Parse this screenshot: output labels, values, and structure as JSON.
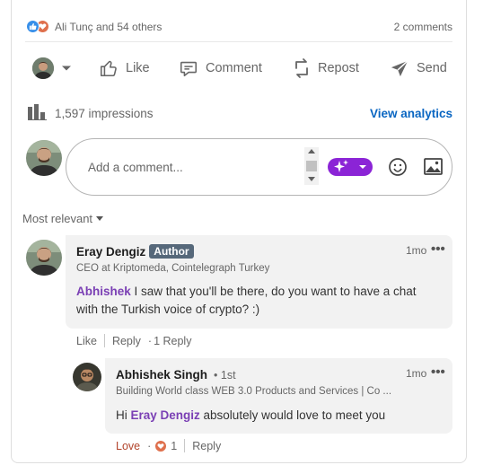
{
  "social": {
    "reactions_text": "Ali Tunç and 54 others",
    "comments_count": "2 comments"
  },
  "actions": {
    "like": "Like",
    "comment": "Comment",
    "repost": "Repost",
    "send": "Send"
  },
  "stats": {
    "impressions": "1,597 impressions",
    "analytics_link": "View analytics"
  },
  "composer": {
    "placeholder": "Add a comment..."
  },
  "sort": {
    "label": "Most relevant"
  },
  "comments": [
    {
      "name": "Eray Dengiz",
      "badge": "Author",
      "headline": "CEO at Kriptomeda, Cointelegraph Turkey",
      "time": "1mo",
      "more": "•••",
      "mention": "Abhishek",
      "text_line1": " I saw that you'll be there, do you want to have a chat",
      "text_line2": "with the Turkish voice of crypto? :)",
      "like_label": "Like",
      "reply_label": "Reply",
      "reply_count": "1 Reply"
    },
    {
      "name": "Abhishek Singh",
      "degree": "• 1st",
      "headline": "Building World class WEB 3.0 Products and Services | Co ...",
      "time": "1mo",
      "more": "•••",
      "text_prefix": "Hi ",
      "mention": "Eray Dengiz",
      "text_suffix": " absolutely would love to meet you",
      "reaction_label": "Love",
      "reaction_count": "1",
      "reply_label": "Reply"
    }
  ],
  "colors": {
    "brand_blue": "#0a66c2",
    "ai_purple": "#8b24d6",
    "mention_purple": "#7a3fb4",
    "love_red": "#b2442b"
  },
  "icons": [
    "like-reaction-icon",
    "love-reaction-icon",
    "chevron-down-icon",
    "thumbs-up-icon",
    "comment-icon",
    "repost-icon",
    "send-icon",
    "bar-chart-icon",
    "sparkle-icon",
    "emoji-icon",
    "image-icon",
    "more-icon"
  ]
}
